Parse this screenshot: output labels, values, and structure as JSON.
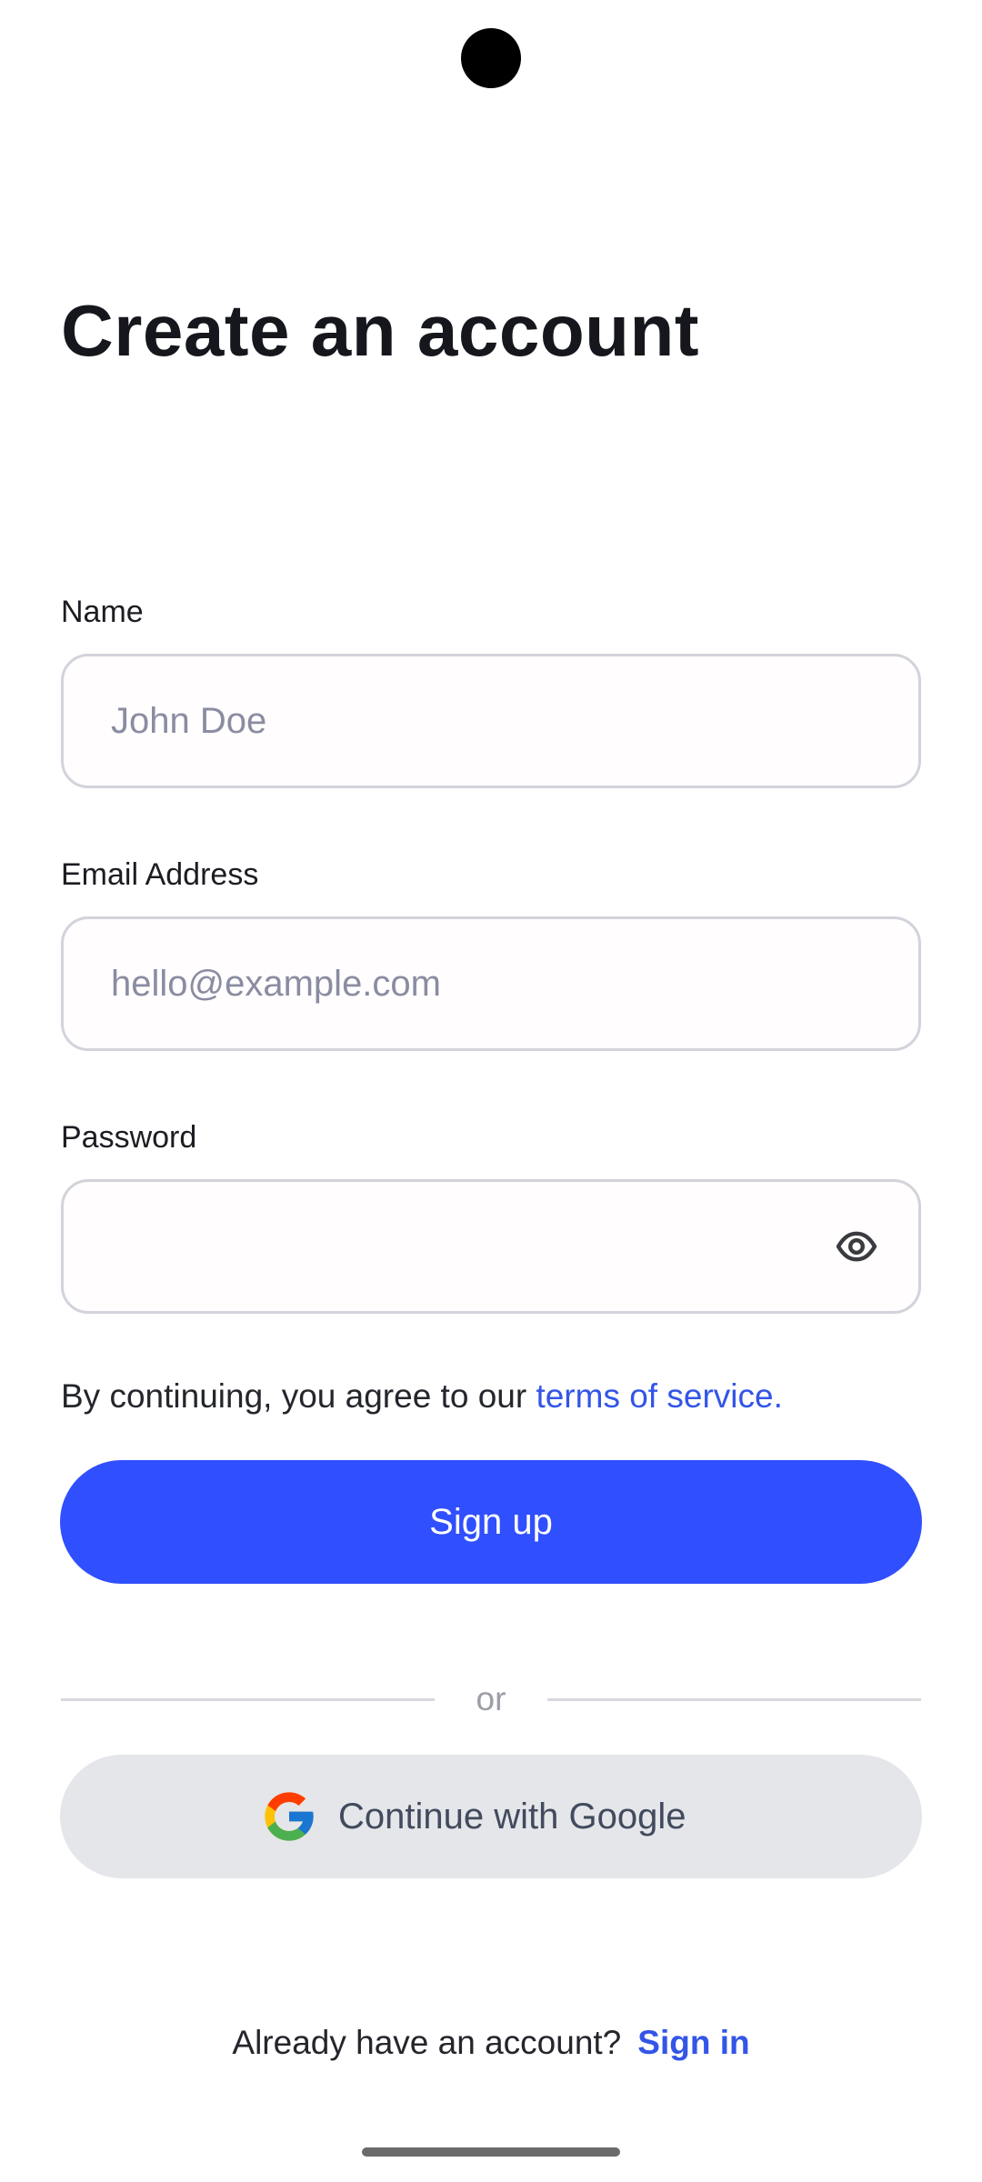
{
  "header": {
    "title": "Create an account"
  },
  "form": {
    "name": {
      "label": "Name",
      "value": "",
      "placeholder": "John Doe"
    },
    "email": {
      "label": "Email Address",
      "value": "",
      "placeholder": "hello@example.com"
    },
    "password": {
      "label": "Password",
      "value": "",
      "placeholder": "",
      "toggle_icon": "eye-icon"
    },
    "terms": {
      "text": "By continuing, you agree to our ",
      "link_text": "terms of service."
    },
    "submit_label": "Sign up"
  },
  "divider": {
    "text": "or"
  },
  "social": {
    "google_label": "Continue with Google",
    "google_icon": "google-icon"
  },
  "footer": {
    "prompt": "Already have an account?",
    "link_text": "Sign in"
  },
  "colors": {
    "accent": "#304ffe",
    "link": "#3355e8",
    "secondary_button": "#e4e6ea",
    "field_border": "#d2d3db",
    "placeholder": "#8a8ca2"
  }
}
